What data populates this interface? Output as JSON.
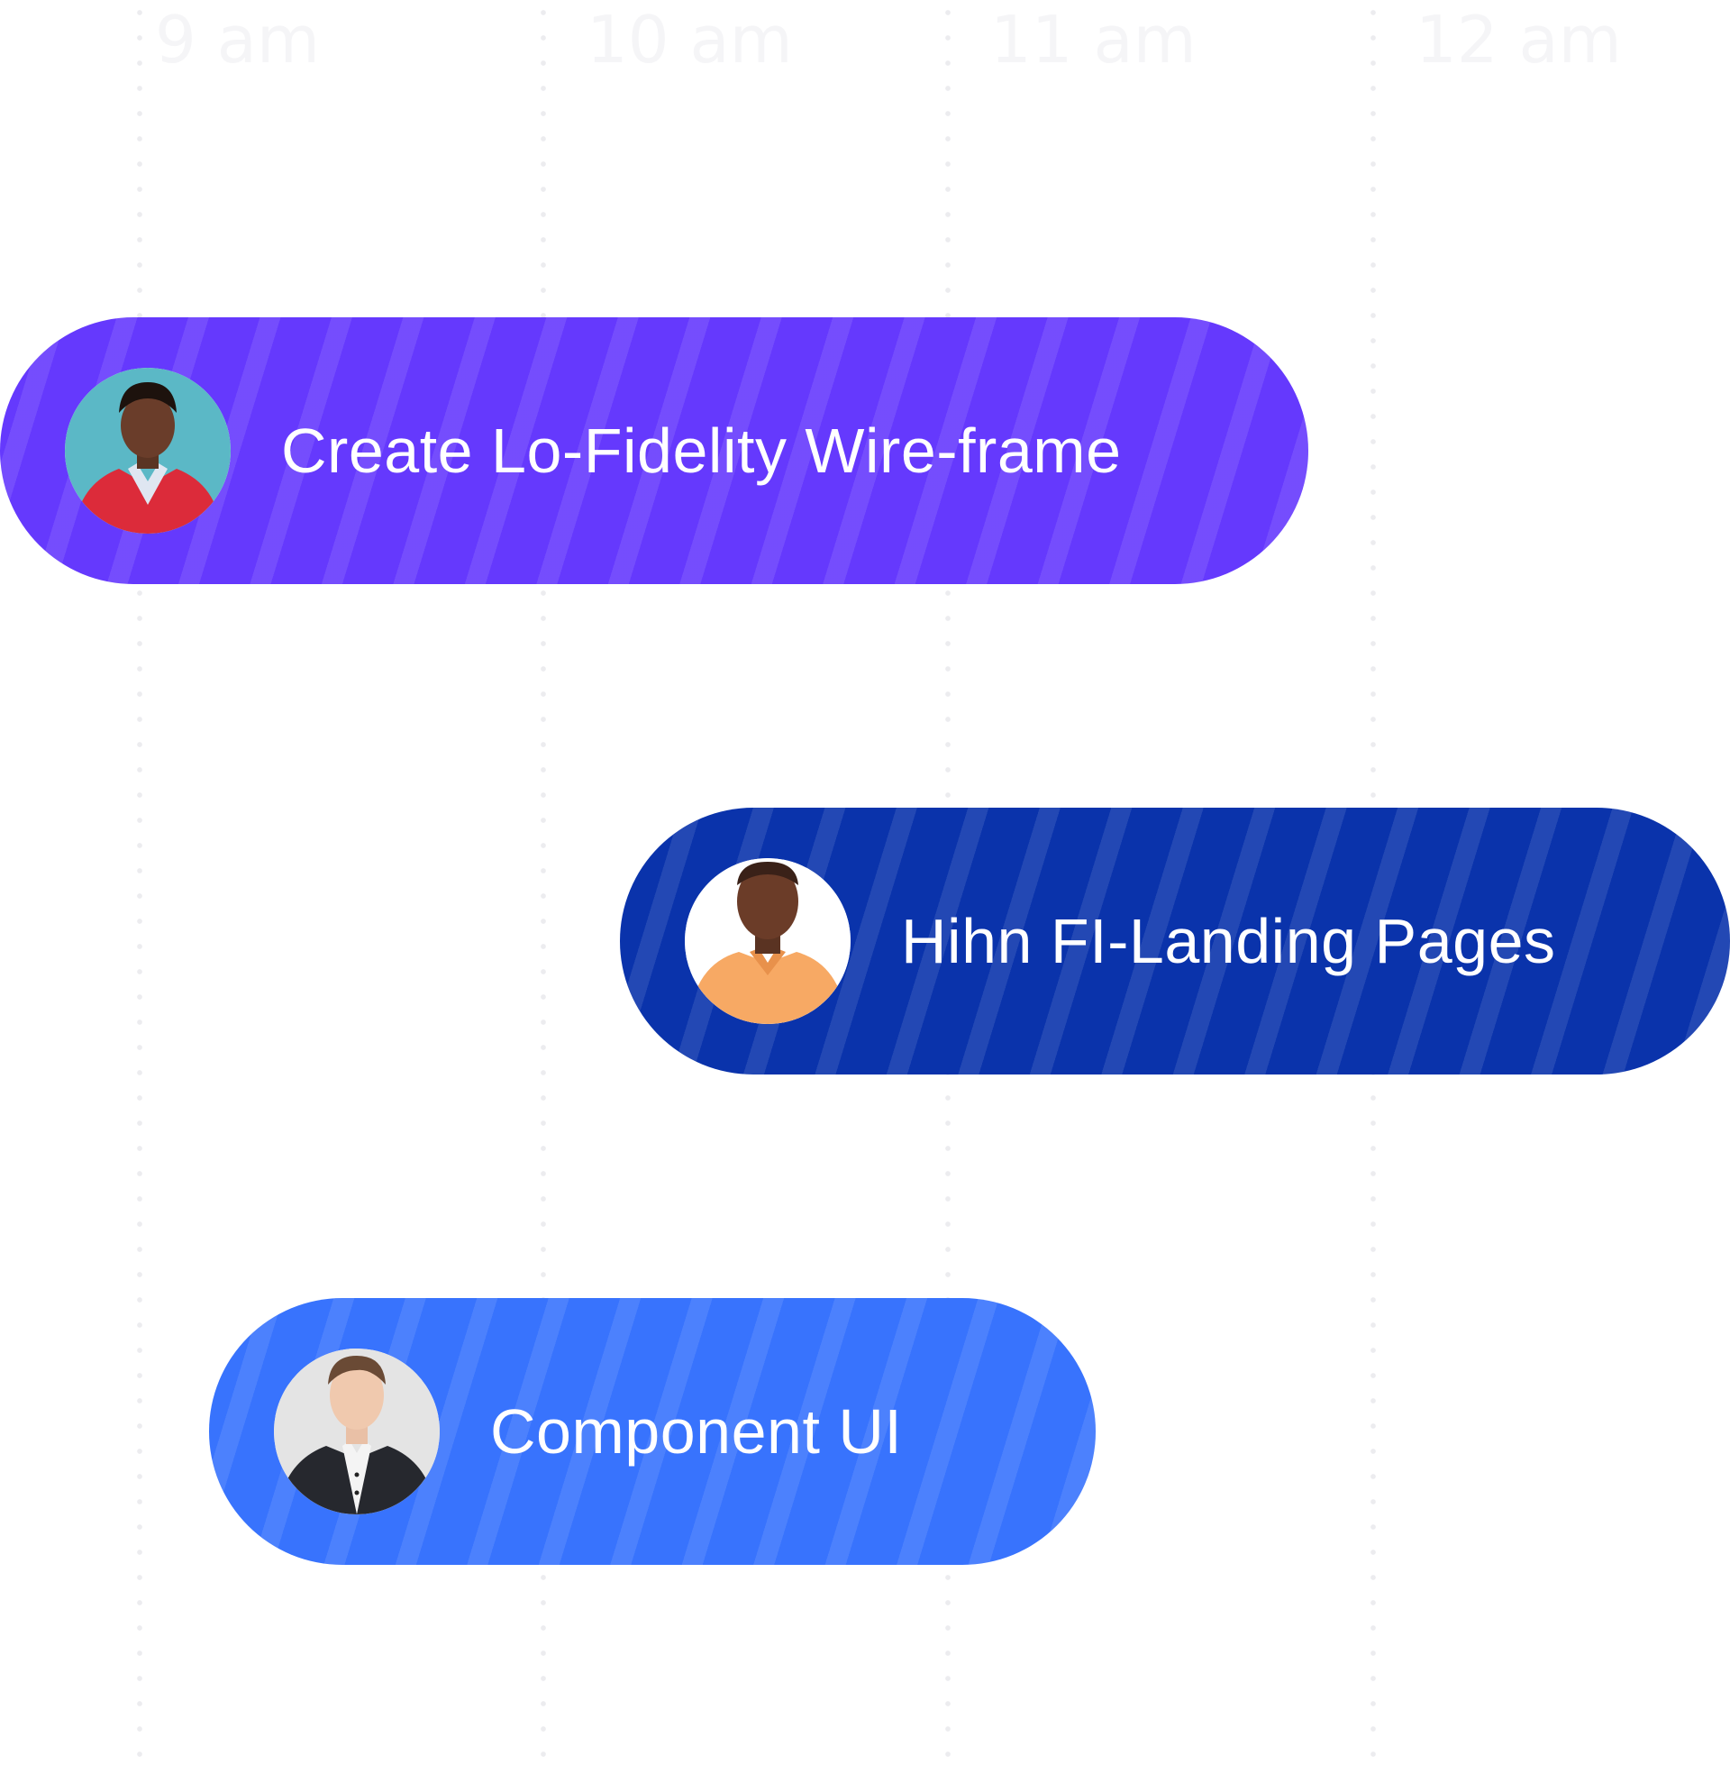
{
  "timeline": {
    "hours": [
      "9 am",
      "10 am",
      "11 am",
      "12 am"
    ]
  },
  "tasks": [
    {
      "title": "Create Lo-Fidelity Wire-frame",
      "color": "#6539fd",
      "avatar": "person-red-sweater-avatar"
    },
    {
      "title": "Hihn FI-Landing Pages",
      "color": "#0a33ab",
      "avatar": "person-orange-polo-avatar"
    },
    {
      "title": "Component UI",
      "color": "#3873fd",
      "avatar": "person-dark-suit-avatar"
    }
  ]
}
